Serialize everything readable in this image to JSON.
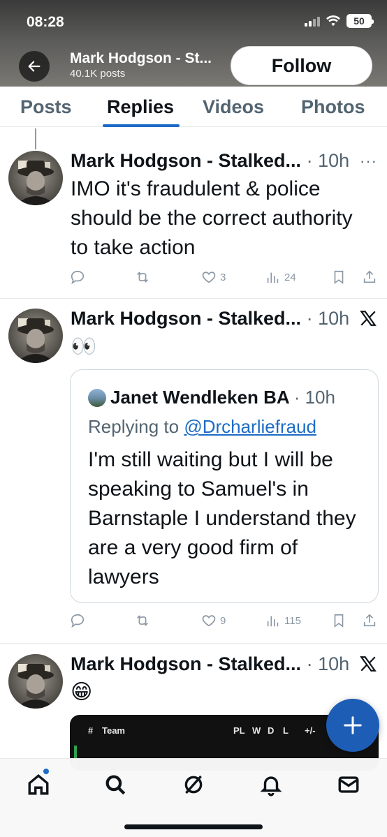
{
  "status_bar": {
    "time": "08:28",
    "battery": "50"
  },
  "header": {
    "profile_name": "Mark Hodgson - St...",
    "posts_count": "40.1K posts",
    "follow_label": "Follow"
  },
  "tabs": [
    {
      "label": "Posts",
      "active": false
    },
    {
      "label": "Replies",
      "active": true
    },
    {
      "label": "Videos",
      "active": false
    },
    {
      "label": "Photos",
      "active": false
    }
  ],
  "posts": [
    {
      "author": "Mark Hodgson - Stalked...",
      "time": "· 10h",
      "text": "IMO it's fraudulent & police should be the correct authority to take action",
      "likes": "3",
      "views": "24",
      "menu_icon": "more-icon"
    },
    {
      "author": "Mark Hodgson - Stalked...",
      "time": "· 10h",
      "text": "👀",
      "likes": "9",
      "views": "115",
      "quote": {
        "author": "Janet Wendleken BA",
        "time": "· 10h",
        "replying_prefix": "Replying to ",
        "replying_handle": "@Drcharliefraud",
        "text": "I'm still waiting but I will be speaking to Samuel's in Barnstaple I understand they are a very good firm of lawyers"
      }
    },
    {
      "author": "Mark Hodgson - Stalked...",
      "time": "· 10h",
      "text": "😁",
      "embed": {
        "col_hash": "#",
        "col_team": "Team",
        "col_pl": "PL",
        "col_w": "W",
        "col_d": "D",
        "col_l": "L",
        "col_gd": "+/-"
      }
    }
  ],
  "colors": {
    "accent": "#1d6bc6",
    "fab": "#1d5db5",
    "muted": "#536471"
  }
}
